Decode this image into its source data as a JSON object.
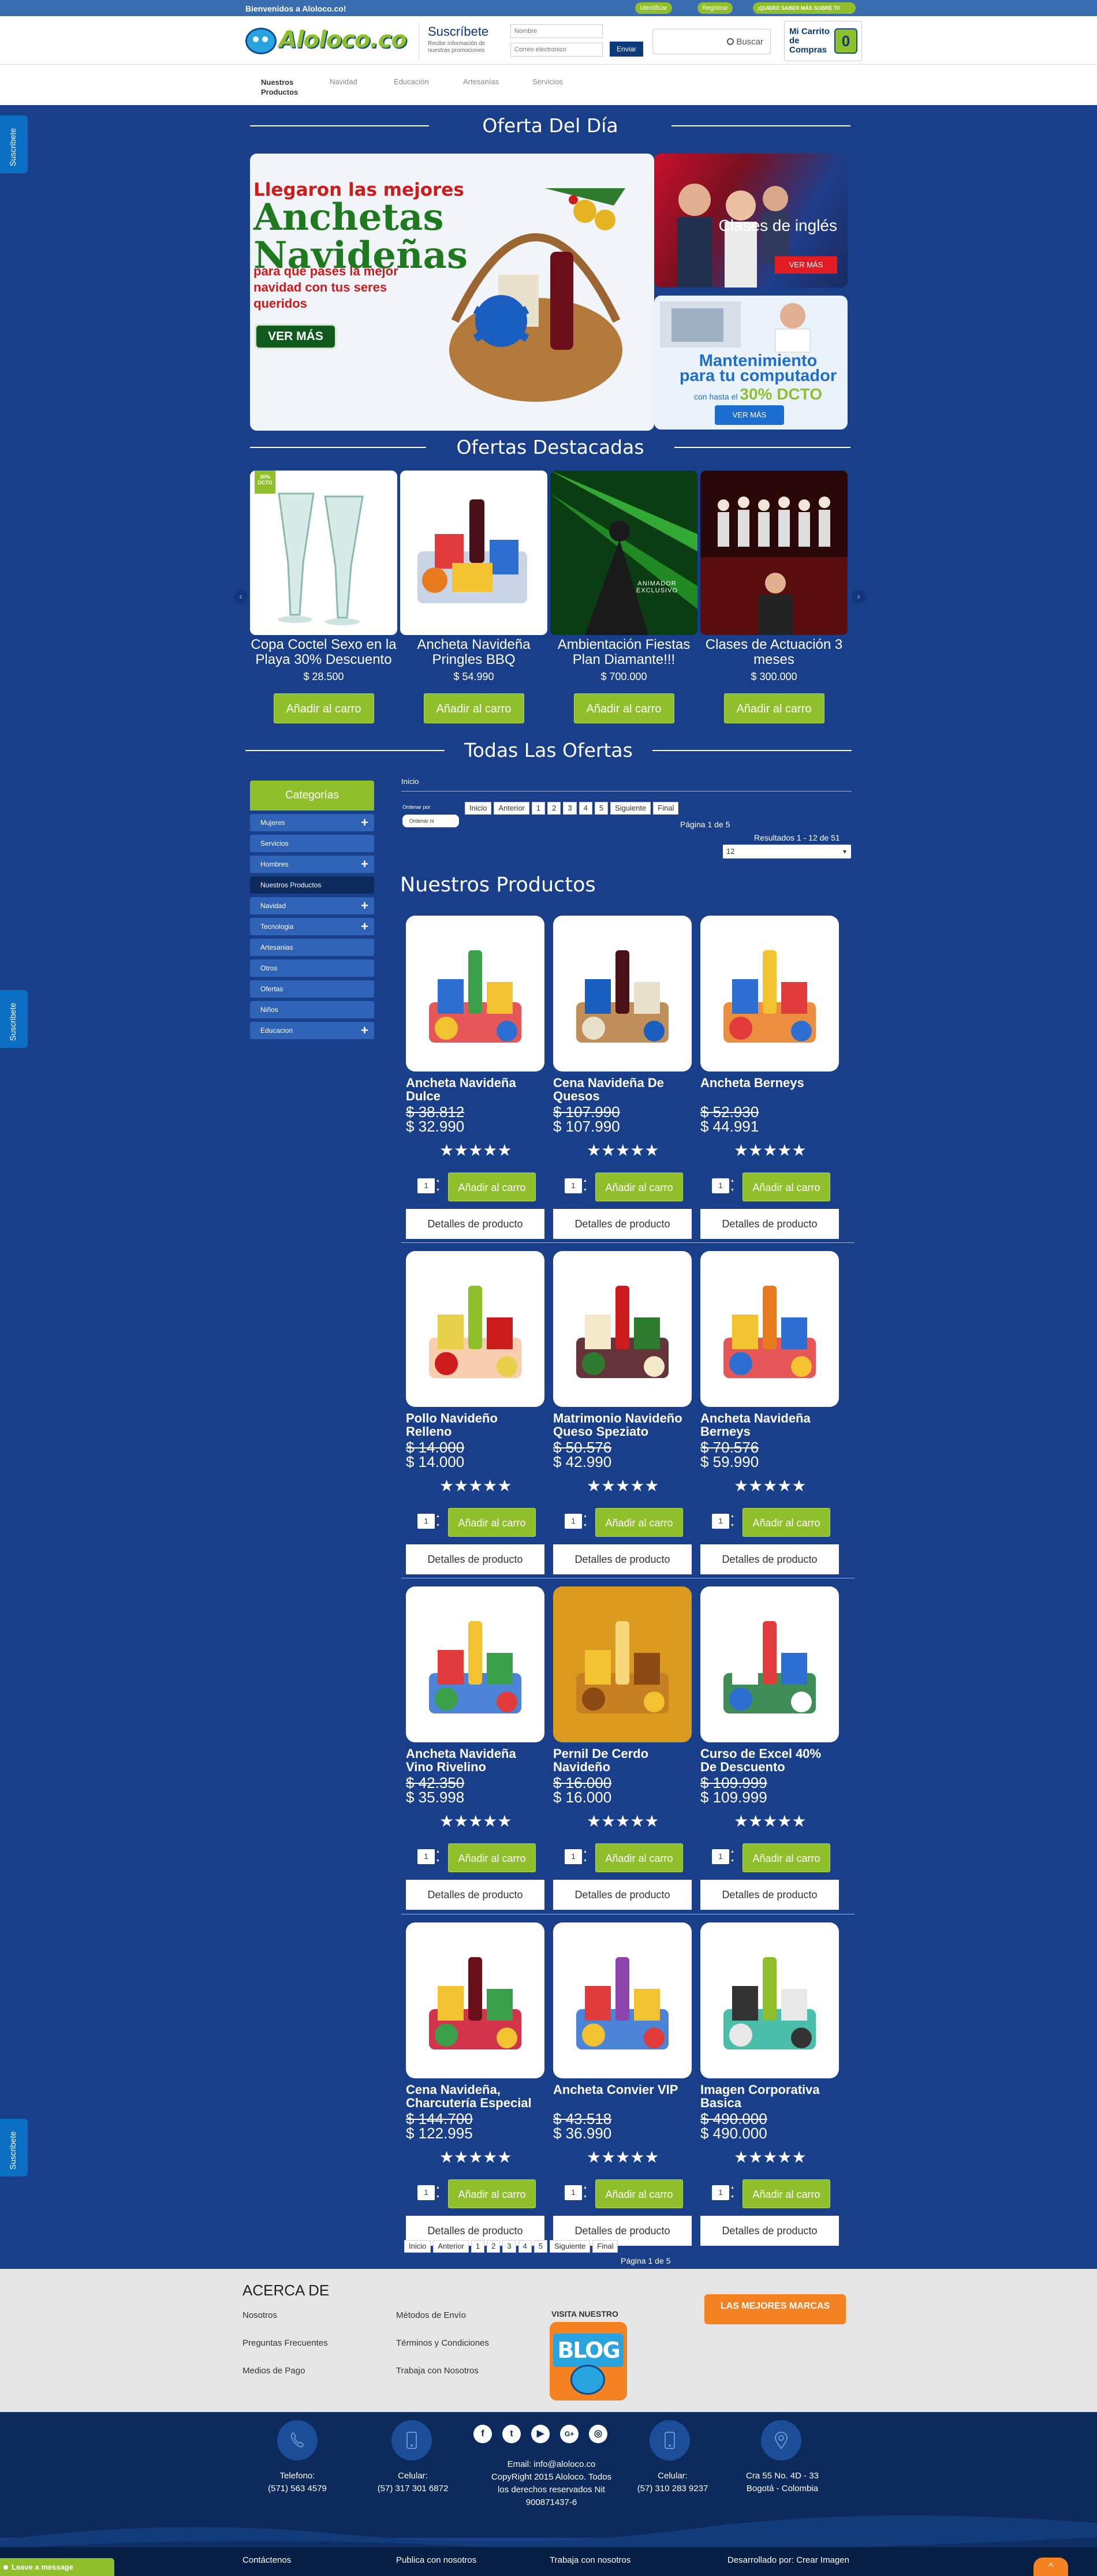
{
  "topbar": {
    "welcome": "Bienvenidos a Aloloco.co!",
    "identificar": "Identificar",
    "registrar": "Registrar",
    "quiero_mas": "¡QUIERO SABER MÁS SOBRE TI!"
  },
  "header": {
    "logo": "Aloloco.co",
    "subscribe_title": "Suscríbete",
    "subscribe_text": "Recibe información de nuestras promociones",
    "name_placeholder": "Nombre",
    "email_placeholder": "Correo electronico",
    "send": "Enviar",
    "search": "Buscar",
    "cart_label": "Mi Carrito de Compras",
    "cart_count": "0"
  },
  "nav": [
    "Nuestros Productos",
    "Navidad",
    "Educación",
    "Artesanías",
    "Servicios"
  ],
  "side_tab": "Suscribete",
  "sections": {
    "deal": "Oferta Del Día",
    "featured": "Ofertas Destacadas",
    "all": "Todas Las Ofertas",
    "products": "Nuestros Productos"
  },
  "banner_main": {
    "line1": "Llegaron las mejores",
    "line2a": "Anchetas",
    "line2b": "Navideñas",
    "line3": "para que pases la mejor navidad con tus seres queridos",
    "button": "VER MÁS"
  },
  "banner_english": {
    "text": "Clases de inglés",
    "button": "VER MÁS"
  },
  "banner_pc": {
    "line1": "Mantenimiento",
    "line2": "para tu computador",
    "line3a": "con hasta el",
    "line3b": "30% DCTO",
    "button": "VER MÁS"
  },
  "featured": [
    {
      "name": "Copa Coctel Sexo en la Playa 30% Descuento",
      "price": "$ 28.500",
      "add": "Añadir al carro",
      "badge": "30% DCTO"
    },
    {
      "name": "Ancheta Navideña Pringles BBQ",
      "price": "$ 54.990",
      "add": "Añadir al carro"
    },
    {
      "name": "Ambientación Fiestas Plan Diamante!!!",
      "price": "$ 700.000",
      "add": "Añadir al carro",
      "overlay": "Animador exclusivo"
    },
    {
      "name": "Clases de Actuación 3 meses",
      "price": "$ 300.000",
      "add": "Añadir al carro"
    }
  ],
  "categories": {
    "title": "Categorías",
    "items": [
      {
        "label": "Mujeres",
        "plus": "+"
      },
      {
        "label": "Servicios",
        "plus": ""
      },
      {
        "label": "Hombres",
        "plus": "+"
      },
      {
        "label": "Nuestros Productos",
        "plus": ""
      },
      {
        "label": "Navidad",
        "plus": "+"
      },
      {
        "label": "Tecnologia",
        "plus": "+"
      },
      {
        "label": "Artesanias",
        "plus": ""
      },
      {
        "label": "Otros",
        "plus": ""
      },
      {
        "label": "Ofertas",
        "plus": ""
      },
      {
        "label": "Niños",
        "plus": ""
      },
      {
        "label": "Educacion",
        "plus": "+"
      }
    ]
  },
  "listing": {
    "breadcrumb": "Inicio",
    "order_label": "Ordenar por",
    "order_value": "Ordenar ni",
    "pager": [
      "Inicio",
      "Anterior",
      "1",
      "2",
      "3",
      "4",
      "5",
      "Siguiente",
      "Final"
    ],
    "page_of": "Página 1 de 5",
    "results": "Resultados 1 - 12 de 51",
    "per_page": "12"
  },
  "products": [
    {
      "name": "Ancheta Navideña Dulce",
      "old": "$ 38.812",
      "new": "$ 32.990"
    },
    {
      "name": "Cena Navideña De Quesos",
      "old": "$ 107.990",
      "new": "$ 107.990"
    },
    {
      "name": "Ancheta Berneys",
      "old": "$ 52.930",
      "new": "$ 44.991"
    },
    {
      "name": "Pollo Navideño Relleno",
      "old": "$ 14.000",
      "new": "$ 14.000"
    },
    {
      "name": "Matrimonio Navideño Queso Speziato",
      "old": "$ 50.576",
      "new": "$ 42.990"
    },
    {
      "name": "Ancheta Navideña Berneys",
      "old": "$ 70.576",
      "new": "$ 59.990"
    },
    {
      "name": "Ancheta Navideña Vino Rivelino",
      "old": "$ 42.350",
      "new": "$ 35.998"
    },
    {
      "name": "Pernil De Cerdo Navideño",
      "old": "$ 16.000",
      "new": "$ 16.000"
    },
    {
      "name": "Curso de Excel 40% De Descuento",
      "old": "$ 109.999",
      "new": "$ 109.999"
    },
    {
      "name": "Cena Navideña, Charcutería Especial",
      "old": "$ 144.700",
      "new": "$ 122.995"
    },
    {
      "name": "Ancheta Convier VIP",
      "old": "$ 43.518",
      "new": "$ 36.990"
    },
    {
      "name": "Imagen Corporativa Basica",
      "old": "$ 490.000",
      "new": "$ 490.000"
    }
  ],
  "product_ui": {
    "stars": "★★★★★",
    "qty": "1",
    "add": "Añadir al carro",
    "details": "Detalles de producto"
  },
  "about": {
    "title": "ACERCA DE",
    "links": [
      "Nosotros",
      "Preguntas Frecuentes",
      "Medios de Pago",
      "Métodos de Envío",
      "Términos y Condiciones",
      "Trabaja con Nosotros"
    ],
    "visit": "VISITA NUESTRO",
    "blog": "BLOG",
    "brands": "LAS MEJORES MARCAS"
  },
  "footer": {
    "phone_label": "Telefono:",
    "phone": "(571) 563 4579",
    "cell_label": "Celular:",
    "cell1": "(57) 317 301 6872",
    "email": "Email: info@aloloco.co",
    "copyright": "CopyRight 2015 Aloloco. Todos los derechos reservados Nit 900871437-6",
    "cell2": "(57) 310 283 9237",
    "address": "Cra 55 No. 4D - 33",
    "city": "Bogotá - Colombia",
    "social": [
      "f",
      "t",
      "▶",
      "G+",
      "◎"
    ]
  },
  "bottom": {
    "contact": "Contáctenos",
    "publish": "Publica con nosotros",
    "work": "Trabaja con nosotros",
    "dev": "Desarrollado por: Crear Imagen",
    "leave": "Leave a message",
    "top": "^"
  }
}
